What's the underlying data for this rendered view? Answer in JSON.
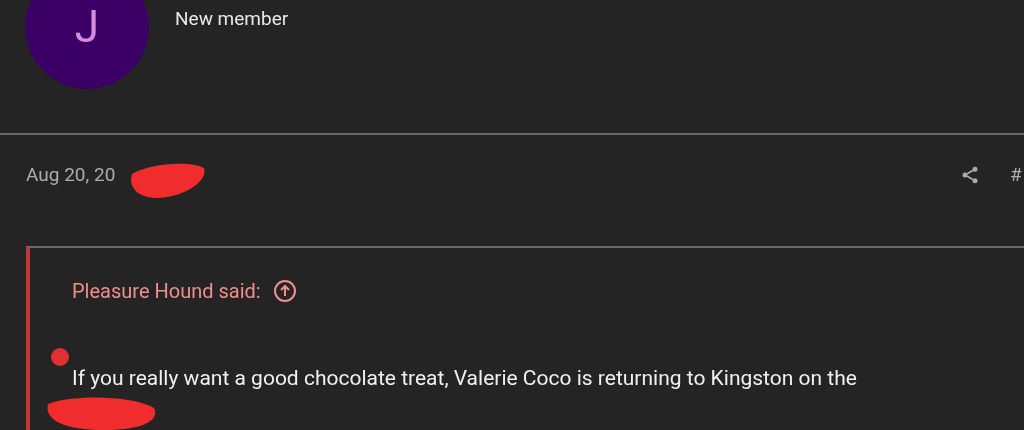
{
  "author": {
    "avatar_letter": "J",
    "role": "New member"
  },
  "post": {
    "date": "Aug 20, 20",
    "post_number": "#",
    "quote": {
      "attribution": "Pleasure Hound said:",
      "text": "If you really want a good chocolate treat, Valerie Coco is returning to Kingston on the"
    }
  }
}
